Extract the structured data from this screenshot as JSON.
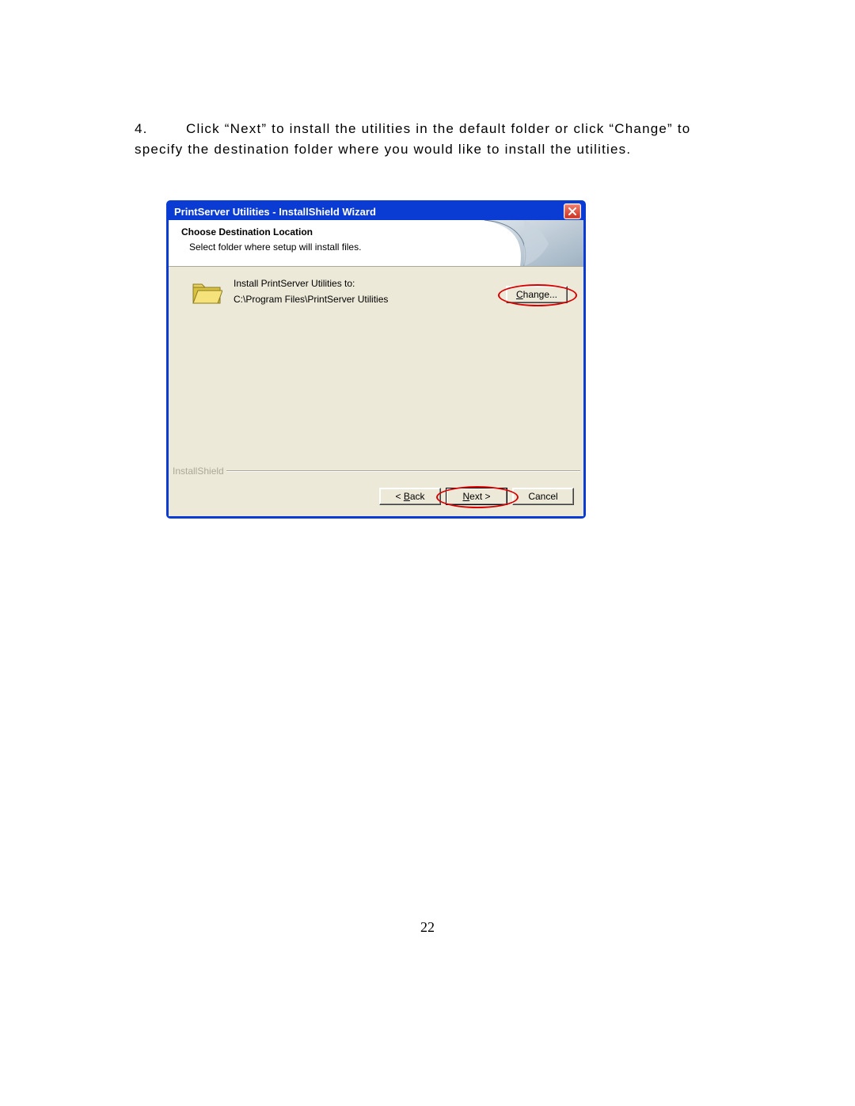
{
  "document": {
    "step_number": "4.",
    "step_text": "Click “Next” to install the utilities in the default folder or click “Change” to specify the destination folder where you would like to install the utilities.",
    "page_number": "22"
  },
  "window": {
    "title": "PrintServer Utilities - InstallShield Wizard",
    "close_icon_name": "close-icon"
  },
  "header": {
    "heading": "Choose Destination Location",
    "subheading": "Select folder where setup will install files."
  },
  "body": {
    "install_to_label": "Install PrintServer Utilities to:",
    "install_path": "C:\\Program Files\\PrintServer Utilities",
    "change_button_prefix": "C",
    "change_button_rest": "hange..."
  },
  "footer": {
    "brand": "InstallShield",
    "back_prefix": "< ",
    "back_ul": "B",
    "back_rest": "ack",
    "next_ul": "N",
    "next_rest": "ext >",
    "cancel": "Cancel"
  }
}
